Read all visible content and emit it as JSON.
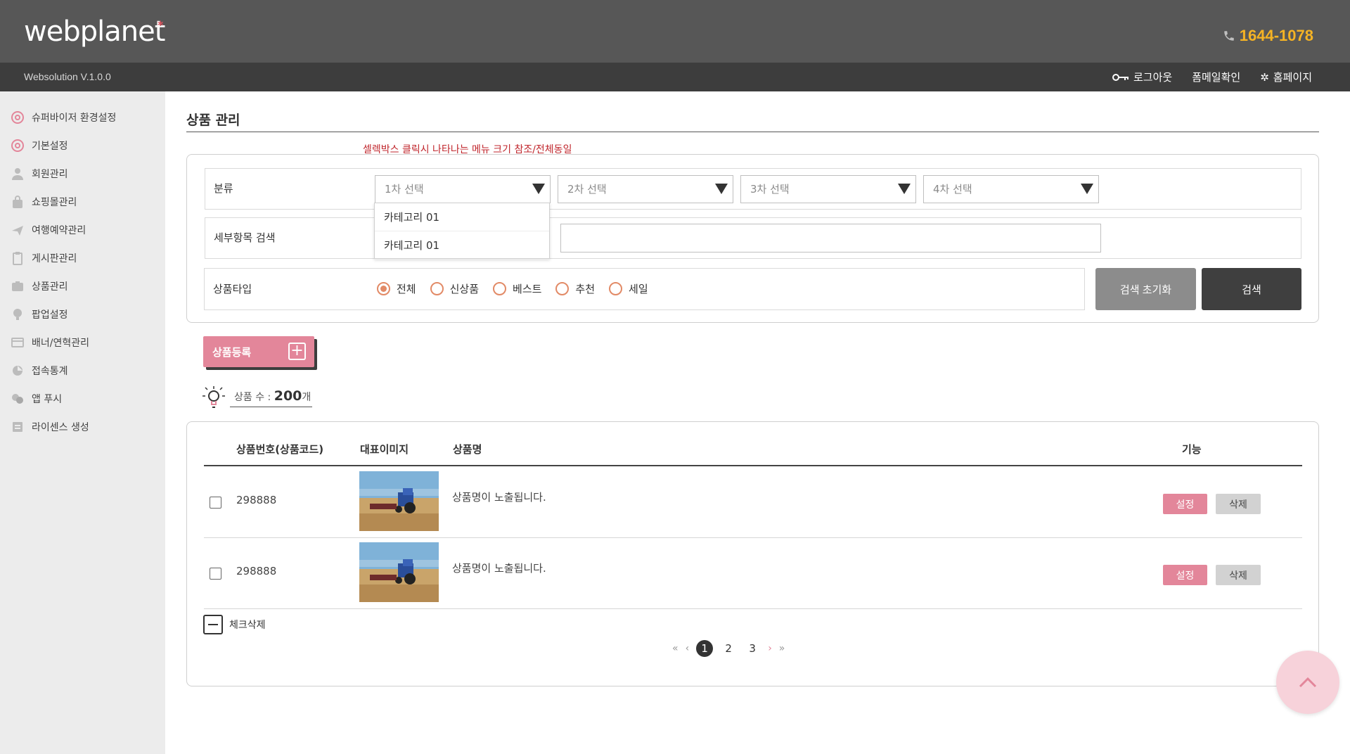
{
  "header": {
    "logo": "webplanet",
    "logo_mark": "*",
    "phone": "1644-1078",
    "version": "Websolution V.1.0.0",
    "links": {
      "logout": "로그아웃",
      "mail_check": "폼메일확인",
      "homepage": "홈페이지"
    }
  },
  "sidebar": {
    "items": [
      {
        "label": "슈퍼바이저 환경설정",
        "icon": "settings-icon"
      },
      {
        "label": "기본설정",
        "icon": "settings-icon"
      },
      {
        "label": "회원관리",
        "icon": "user-icon"
      },
      {
        "label": "쇼핑몰관리",
        "icon": "bag-icon"
      },
      {
        "label": "여행예약관리",
        "icon": "plane-icon"
      },
      {
        "label": "게시판관리",
        "icon": "clipboard-icon"
      },
      {
        "label": "상품관리",
        "icon": "box-icon"
      },
      {
        "label": "팝업설정",
        "icon": "bulb-icon"
      },
      {
        "label": "배너/연혁관리",
        "icon": "card-icon"
      },
      {
        "label": "접속통계",
        "icon": "chart-icon"
      },
      {
        "label": "앱 푸시",
        "icon": "chat-icon"
      },
      {
        "label": "라이센스 생성",
        "icon": "license-icon"
      }
    ]
  },
  "main": {
    "title": "상품 관리",
    "note": "셀렉박스 클릭시 나타나는 메뉴 크기 참조/전체동일",
    "search": {
      "category_label": "분류",
      "selects": [
        "1차 선택",
        "2차 선택",
        "3차 선택",
        "4차 선택"
      ],
      "dropdown_options": [
        "카테고리 01",
        "카테고리 01"
      ],
      "detail_label": "세부항목 검색",
      "detail_value": "",
      "type_label": "상품타입",
      "types": [
        "전체",
        "신상품",
        "베스트",
        "추천",
        "세일"
      ],
      "selected_type": "전체",
      "reset_label": "검색 초기화",
      "search_label": "검색"
    },
    "register_label": "상품등록",
    "count": {
      "prefix": "상품 수 : ",
      "value": "200",
      "suffix": "개"
    },
    "table": {
      "headers": {
        "code": "상품번호(상품코드)",
        "image": "대표이미지",
        "name": "상품명",
        "actions": "기능"
      },
      "rows": [
        {
          "code": "298888",
          "name": "상품명이 노출됩니다.",
          "set_label": "설정",
          "delete_label": "삭제",
          "checked": false
        },
        {
          "code": "298888",
          "name": "상품명이 노출됩니다.",
          "set_label": "설정",
          "delete_label": "삭제",
          "checked": false
        }
      ]
    },
    "check_delete_label": "체크삭제",
    "pagination": {
      "pages": [
        "1",
        "2",
        "3"
      ],
      "current": "1",
      "first": "«",
      "prev": "‹",
      "next": "›",
      "last": "»"
    }
  },
  "colors": {
    "accent": "#e3869a",
    "header": "#575757",
    "subheader": "#3d3d3d",
    "phone": "#f5b324",
    "note": "#c0262c",
    "radio": "#e28a66"
  }
}
